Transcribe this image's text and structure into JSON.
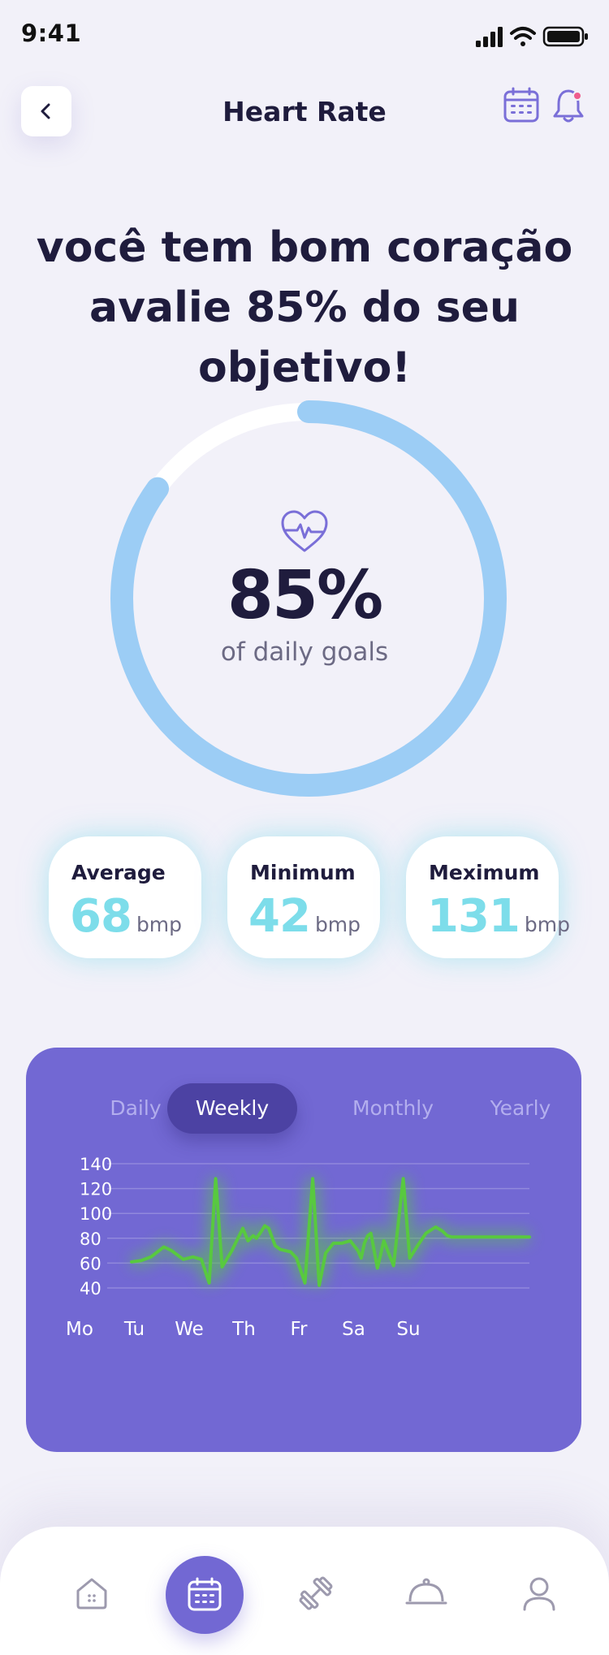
{
  "status_bar": {
    "time": "9:41"
  },
  "header": {
    "title": "Heart Rate"
  },
  "headline": {
    "line1": "você tem bom coração",
    "line2": "avalie 85% do seu objetivo!"
  },
  "progress": {
    "value": 85,
    "value_label": "85%",
    "caption": "of daily goals",
    "ring_color": "#9ccdf5",
    "track_color": "#ffffff"
  },
  "stats": [
    {
      "label": "Average",
      "value": "68",
      "unit": "bmp"
    },
    {
      "label": "Minimum",
      "value": "42",
      "unit": "bmp"
    },
    {
      "label": "Meximum",
      "value": "131",
      "unit": "bmp"
    }
  ],
  "chart_tabs": {
    "items": [
      "Daily",
      "Weekly",
      "Monthly",
      "Yearly"
    ],
    "active": "Weekly"
  },
  "chart_data": {
    "type": "line",
    "title": "",
    "xlabel": "",
    "ylabel": "",
    "categories": [
      "Mo",
      "Tu",
      "We",
      "Th",
      "Fr",
      "Sa",
      "Su"
    ],
    "yticks": [
      140,
      120,
      100,
      80,
      60,
      40
    ],
    "ylim": [
      40,
      140
    ],
    "grid": true,
    "line_color": "#58c93f",
    "series": [
      {
        "x": [
          0,
          0.15,
          0.3,
          0.5,
          0.62,
          0.8,
          0.95,
          1.08,
          1.2,
          1.3,
          1.4,
          1.55,
          1.72,
          1.8,
          1.88,
          1.93,
          2.0,
          2.06,
          2.12,
          2.22,
          2.3,
          2.38,
          2.46,
          2.55,
          2.68,
          2.8,
          2.9,
          3.0,
          3.12,
          3.25,
          3.38,
          3.5,
          3.55,
          3.6,
          3.65,
          3.7,
          3.8,
          3.9,
          4.05,
          4.2,
          4.3,
          4.42,
          4.55,
          4.7,
          4.8,
          4.88,
          4.95,
          5.02,
          5.08,
          5.15,
          5.22,
          5.35,
          5.48,
          5.55,
          5.65,
          5.8,
          5.95,
          6.05,
          6.15
        ],
        "values": [
          61,
          62,
          65,
          73,
          70,
          63,
          65,
          63,
          44,
          128,
          57,
          70,
          88,
          78,
          82,
          80,
          85,
          90,
          88,
          74,
          71,
          70,
          69,
          64,
          44,
          128,
          42,
          68,
          76,
          76,
          78,
          70,
          64,
          76,
          82,
          84,
          56,
          78,
          58,
          128,
          64,
          74,
          84,
          89,
          86,
          82,
          81,
          81,
          81,
          81,
          81,
          81,
          81,
          81,
          81,
          81,
          81,
          81,
          81
        ]
      }
    ]
  },
  "bottom_nav": {
    "items": [
      "home-icon",
      "calendar-icon",
      "dumbbell-icon",
      "cloche-icon",
      "profile-icon"
    ],
    "active": "calendar-icon"
  }
}
